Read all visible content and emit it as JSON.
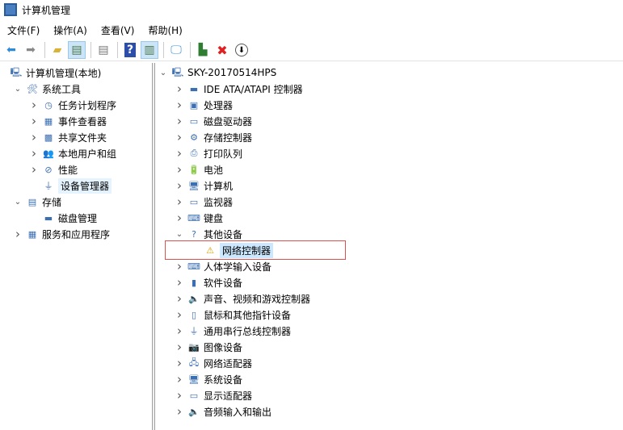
{
  "window": {
    "title": "计算机管理"
  },
  "menu": [
    "文件(F)",
    "操作(A)",
    "查看(V)",
    "帮助(H)"
  ],
  "toolbar": [
    "back-icon",
    "forward-icon",
    "up-folder-icon",
    "show-hide-tree-icon",
    "properties-icon",
    "help-icon",
    "show-action-pane-icon",
    "scan-hardware-icon",
    "update-driver-icon",
    "uninstall-icon",
    "disable-icon"
  ],
  "left_tree": [
    {
      "label": "计算机管理(本地)",
      "level": 0,
      "expanded": null
    },
    {
      "label": "系统工具",
      "level": 1,
      "expanded": true
    },
    {
      "label": "任务计划程序",
      "level": 2,
      "expanded": false
    },
    {
      "label": "事件查看器",
      "level": 2,
      "expanded": false
    },
    {
      "label": "共享文件夹",
      "level": 2,
      "expanded": false
    },
    {
      "label": "本地用户和组",
      "level": 2,
      "expanded": false
    },
    {
      "label": "性能",
      "level": 2,
      "expanded": false
    },
    {
      "label": "设备管理器",
      "level": 2,
      "expanded": null,
      "selected": true
    },
    {
      "label": "存储",
      "level": 1,
      "expanded": true
    },
    {
      "label": "磁盘管理",
      "level": 2,
      "expanded": null
    },
    {
      "label": "服务和应用程序",
      "level": 1,
      "expanded": false
    }
  ],
  "device_tree": {
    "root": "SKY-20170514HPS",
    "items": [
      {
        "label": "IDE ATA/ATAPI 控制器",
        "icon": "ide-controller-icon",
        "glyph": "▬"
      },
      {
        "label": "处理器",
        "icon": "processor-icon",
        "glyph": "▣"
      },
      {
        "label": "磁盘驱动器",
        "icon": "disk-drive-icon",
        "glyph": "▭"
      },
      {
        "label": "存储控制器",
        "icon": "storage-controller-icon",
        "glyph": "⚙"
      },
      {
        "label": "打印队列",
        "icon": "printer-icon",
        "glyph": "⎙"
      },
      {
        "label": "电池",
        "icon": "battery-icon",
        "glyph": "🔋"
      },
      {
        "label": "计算机",
        "icon": "computer-icon",
        "glyph": "🖥"
      },
      {
        "label": "监视器",
        "icon": "monitor-icon",
        "glyph": "▭"
      },
      {
        "label": "键盘",
        "icon": "keyboard-icon",
        "glyph": "⌨"
      },
      {
        "label": "其他设备",
        "icon": "other-devices-icon",
        "glyph": "?",
        "expanded": true,
        "children": [
          {
            "label": "网络控制器",
            "icon": "warning-device-icon",
            "glyph": "⚠"
          }
        ]
      },
      {
        "label": "人体学输入设备",
        "icon": "hid-icon",
        "glyph": "⌨"
      },
      {
        "label": "软件设备",
        "icon": "software-device-icon",
        "glyph": "▮"
      },
      {
        "label": "声音、视频和游戏控制器",
        "icon": "sound-icon",
        "glyph": "🔈"
      },
      {
        "label": "鼠标和其他指针设备",
        "icon": "mouse-icon",
        "glyph": "▯"
      },
      {
        "label": "通用串行总线控制器",
        "icon": "usb-icon",
        "glyph": "⏚"
      },
      {
        "label": "图像设备",
        "icon": "camera-icon",
        "glyph": "📷"
      },
      {
        "label": "网络适配器",
        "icon": "network-adapter-icon",
        "glyph": "🖧"
      },
      {
        "label": "系统设备",
        "icon": "system-device-icon",
        "glyph": "🖥"
      },
      {
        "label": "显示适配器",
        "icon": "display-adapter-icon",
        "glyph": "▭"
      },
      {
        "label": "音频输入和输出",
        "icon": "audio-icon",
        "glyph": "🔈"
      }
    ]
  }
}
